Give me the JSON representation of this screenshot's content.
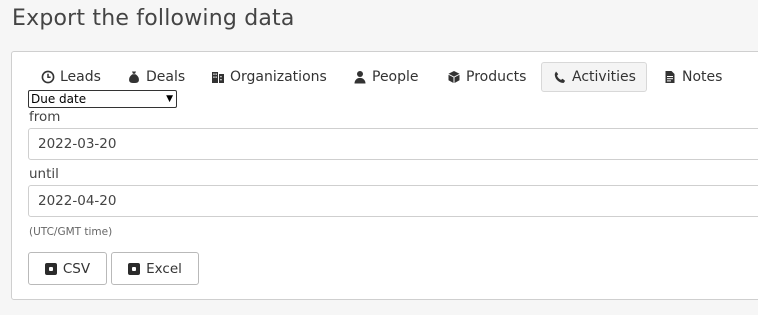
{
  "page": {
    "title": "Export the following data"
  },
  "tabs": [
    {
      "label": "Leads",
      "icon": "clock-icon",
      "active": false
    },
    {
      "label": "Deals",
      "icon": "money-bag-icon",
      "active": false
    },
    {
      "label": "Organizations",
      "icon": "building-icon",
      "active": false
    },
    {
      "label": "People",
      "icon": "person-icon",
      "active": false
    },
    {
      "label": "Products",
      "icon": "box-icon",
      "active": false
    },
    {
      "label": "Activities",
      "icon": "phone-icon",
      "active": true
    },
    {
      "label": "Notes",
      "icon": "document-icon",
      "active": false
    }
  ],
  "filter": {
    "field_selected": "Due date",
    "from_label": "from",
    "from_value": "2022-03-20",
    "until_label": "until",
    "until_value": "2022-04-20",
    "timezone_note": "(UTC/GMT time)"
  },
  "buttons": {
    "csv_label": "CSV",
    "excel_label": "Excel"
  }
}
